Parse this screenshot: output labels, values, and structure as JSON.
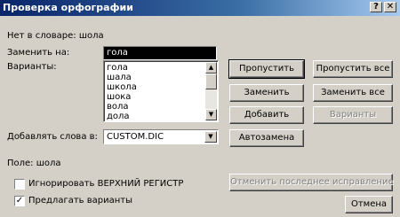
{
  "window": {
    "title": "Проверка орфографии",
    "help_glyph": "?",
    "close_glyph": "✕"
  },
  "not_in_dictionary": "Нет в словаре: шола",
  "replace_with": {
    "label": "Заменить на:",
    "value": "гола"
  },
  "suggestions": {
    "label": "Варианты:",
    "items": [
      "гола",
      "шала",
      "школа",
      "шока",
      "вола",
      "дола"
    ]
  },
  "add_words_to": {
    "label": "Добавлять слова в:",
    "value": "CUSTOM.DIC"
  },
  "field_label": "Поле: шола",
  "checkboxes": {
    "ignore_uppercase": {
      "label": "Игнорировать ВЕРХНИЙ РЕГИСТР",
      "checked": false
    },
    "suggest": {
      "label": "Предлагать варианты",
      "checked": true
    }
  },
  "buttons": {
    "skip": "Пропустить",
    "skip_all": "Пропустить все",
    "replace": "Заменить",
    "replace_all": "Заменить все",
    "add": "Добавить",
    "suggestions": "Варианты",
    "autocorrect": "Автозамена",
    "undo_last": "Отменить последнее исправление",
    "cancel": "Отмена"
  }
}
